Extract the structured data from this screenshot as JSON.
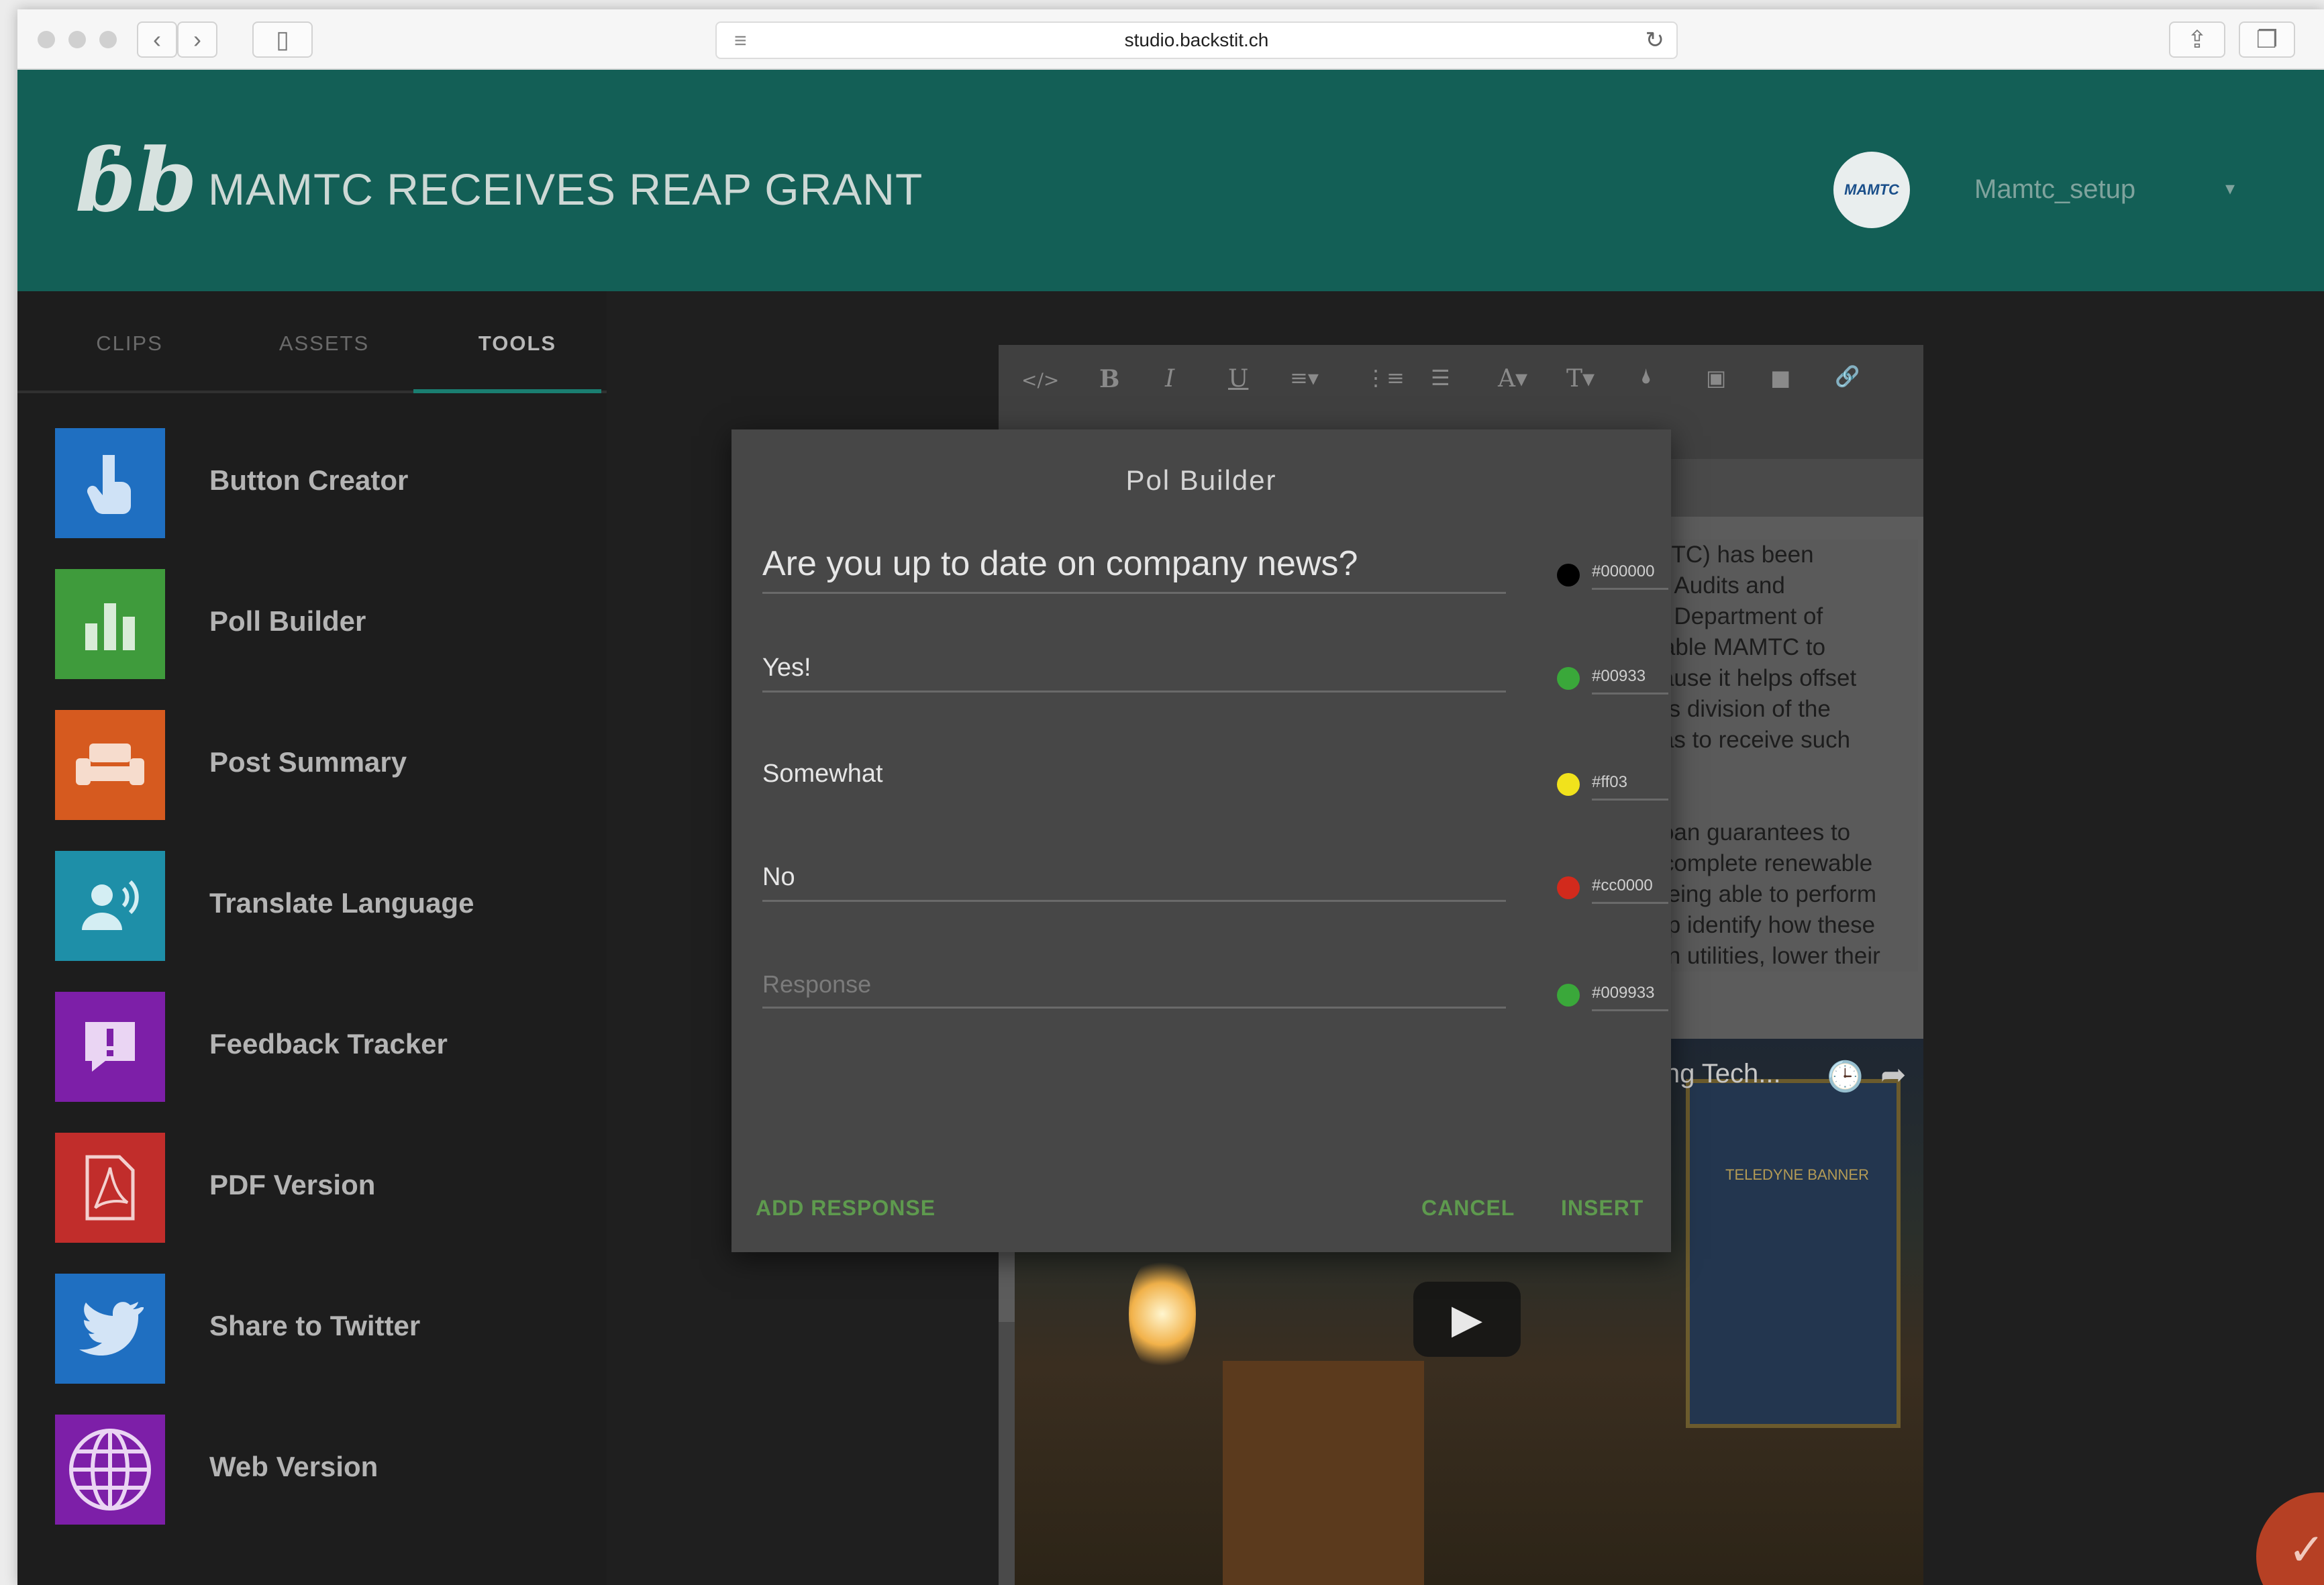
{
  "browser": {
    "url": "studio.backstit.ch",
    "back_icon": "‹",
    "forward_icon": "›",
    "sidebar_icon": "▯",
    "reader_icon": "≡",
    "reload_icon": "↻",
    "share_icon": "⇪",
    "tabs_icon": "❐"
  },
  "header": {
    "logo": "ɓb",
    "title": "MAMTC RECEIVES REAP GRANT",
    "avatar_text": "MAMTC",
    "username": "Mamtc_setup",
    "caret": "▾"
  },
  "sidebar": {
    "tabs": [
      {
        "label": "CLIPS"
      },
      {
        "label": "ASSETS"
      },
      {
        "label": "TOOLS"
      }
    ],
    "tools": [
      {
        "label": "Button Creator",
        "icon": "hand-pointer-icon",
        "color": "#1f6fc1"
      },
      {
        "label": "Poll Builder",
        "icon": "bar-chart-icon",
        "color": "#3f9b3c"
      },
      {
        "label": "Post Summary",
        "icon": "couch-icon",
        "color": "#d65a1f"
      },
      {
        "label": "Translate Language",
        "icon": "speaker-person-icon",
        "color": "#1e8fa8"
      },
      {
        "label": "Feedback Tracker",
        "icon": "exclamation-comment-icon",
        "color": "#7d1fa8"
      },
      {
        "label": "PDF Version",
        "icon": "pdf-icon",
        "color": "#c12d2b"
      },
      {
        "label": "Share to Twitter",
        "icon": "twitter-icon",
        "color": "#1f6fc1"
      },
      {
        "label": "Web Version",
        "icon": "globe-icon",
        "color": "#7d1fa8"
      }
    ]
  },
  "editor": {
    "toolbar": [
      "</>",
      "B",
      "I",
      "U",
      "≡▾",
      "⋮≡",
      "☰",
      "A▾",
      "T▾",
      "🌢",
      "▣",
      "■",
      "🔗"
    ],
    "text_lines": [
      "AMTC) has been",
      "rgy Audits and",
      "tes Department of",
      "enable MAMTC to",
      "ecause it helps offset",
      "rsas division of the",
      "nsas to receive such",
      "",
      "",
      "d loan guarantees to",
      "to complete renewable",
      "y being able to perform",
      "help identify how these",
      "y on utilities, lower their"
    ],
    "video_title": "ing Tech...",
    "video_clock_icon": "🕒",
    "video_share_icon": "➦",
    "play_icon": "▶",
    "banner_text": "TELEDYNE BANNER"
  },
  "dialog": {
    "title": "Pol Builder",
    "question": {
      "value": "Are you up to date on company news?",
      "color": "#000000",
      "hex": "#000000"
    },
    "responses": [
      {
        "value": "Yes!",
        "placeholder": "",
        "color": "#3aa83a",
        "hex": "#00933"
      },
      {
        "value": "Somewhat",
        "placeholder": "",
        "color": "#f1e21c",
        "hex": "#ff03"
      },
      {
        "value": "No",
        "placeholder": "",
        "color": "#d22a1c",
        "hex": "#cc0000"
      },
      {
        "value": "",
        "placeholder": "Response",
        "color": "#3aa83a",
        "hex": "#009933"
      }
    ],
    "add_response": "ADD RESPONSE",
    "cancel": "CANCEL",
    "insert": "INSERT"
  },
  "fab": {
    "icon": "✓"
  }
}
